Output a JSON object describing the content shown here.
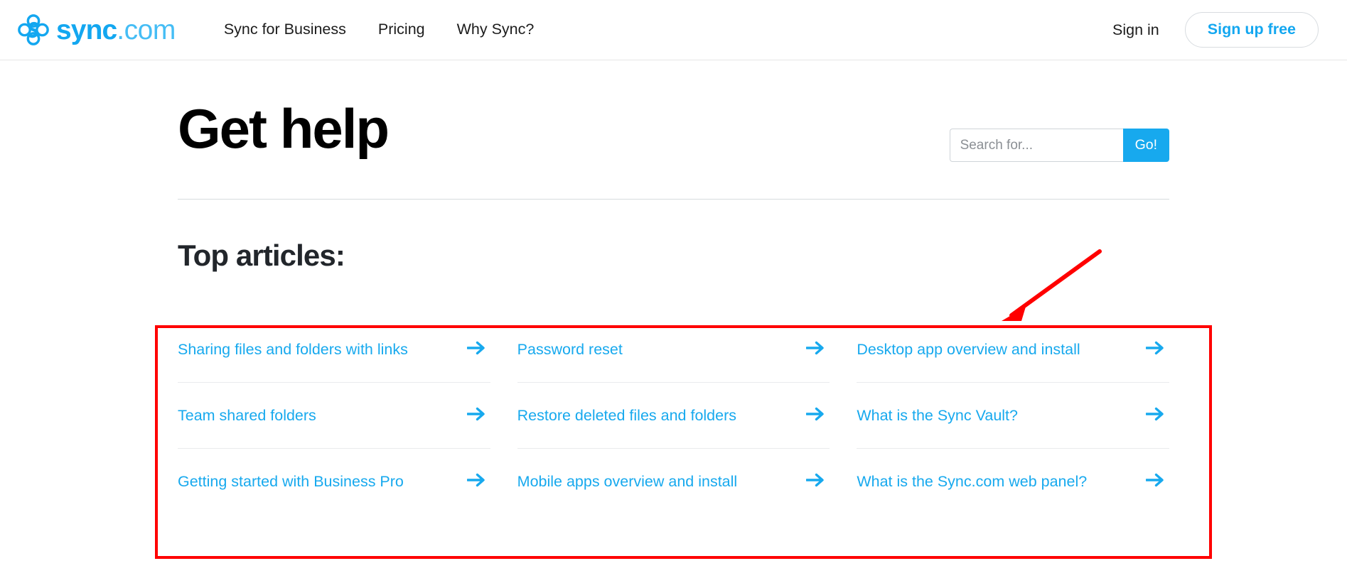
{
  "header": {
    "brand": {
      "logo_icon": "sync-clover-logo-icon",
      "name": "sync",
      "suffix": ".com"
    },
    "nav": [
      {
        "label": "Sync for Business"
      },
      {
        "label": "Pricing"
      },
      {
        "label": "Why Sync?"
      }
    ],
    "sign_in_label": "Sign in",
    "sign_up_label": "Sign up free"
  },
  "main": {
    "page_title": "Get help",
    "search": {
      "placeholder": "Search for...",
      "value": "",
      "button_label": "Go!"
    },
    "section_title": "Top articles:",
    "articles": [
      {
        "label": "Sharing files and folders with links",
        "arrow": "arrow-right-icon"
      },
      {
        "label": "Password reset",
        "arrow": "arrow-right-icon"
      },
      {
        "label": "Desktop app overview and install",
        "arrow": "arrow-right-icon"
      },
      {
        "label": "Team shared folders",
        "arrow": "arrow-right-icon"
      },
      {
        "label": "Restore deleted files and folders",
        "arrow": "arrow-right-icon"
      },
      {
        "label": "What is the Sync Vault?",
        "arrow": "arrow-right-icon"
      },
      {
        "label": "Getting started with Business Pro",
        "arrow": "arrow-right-icon"
      },
      {
        "label": "Mobile apps overview and install",
        "arrow": "arrow-right-icon"
      },
      {
        "label": "What is the Sync.com web panel?",
        "arrow": "arrow-right-icon"
      }
    ]
  },
  "annotations": {
    "highlight_color": "#ff0000",
    "box_target": "top-articles-grid",
    "arrow_target": "top-articles-grid"
  },
  "colors": {
    "brand_blue": "#13a7f0",
    "link_blue": "#17a9ee",
    "text_dark": "#22262b",
    "rule_gray": "#d7dbde"
  }
}
